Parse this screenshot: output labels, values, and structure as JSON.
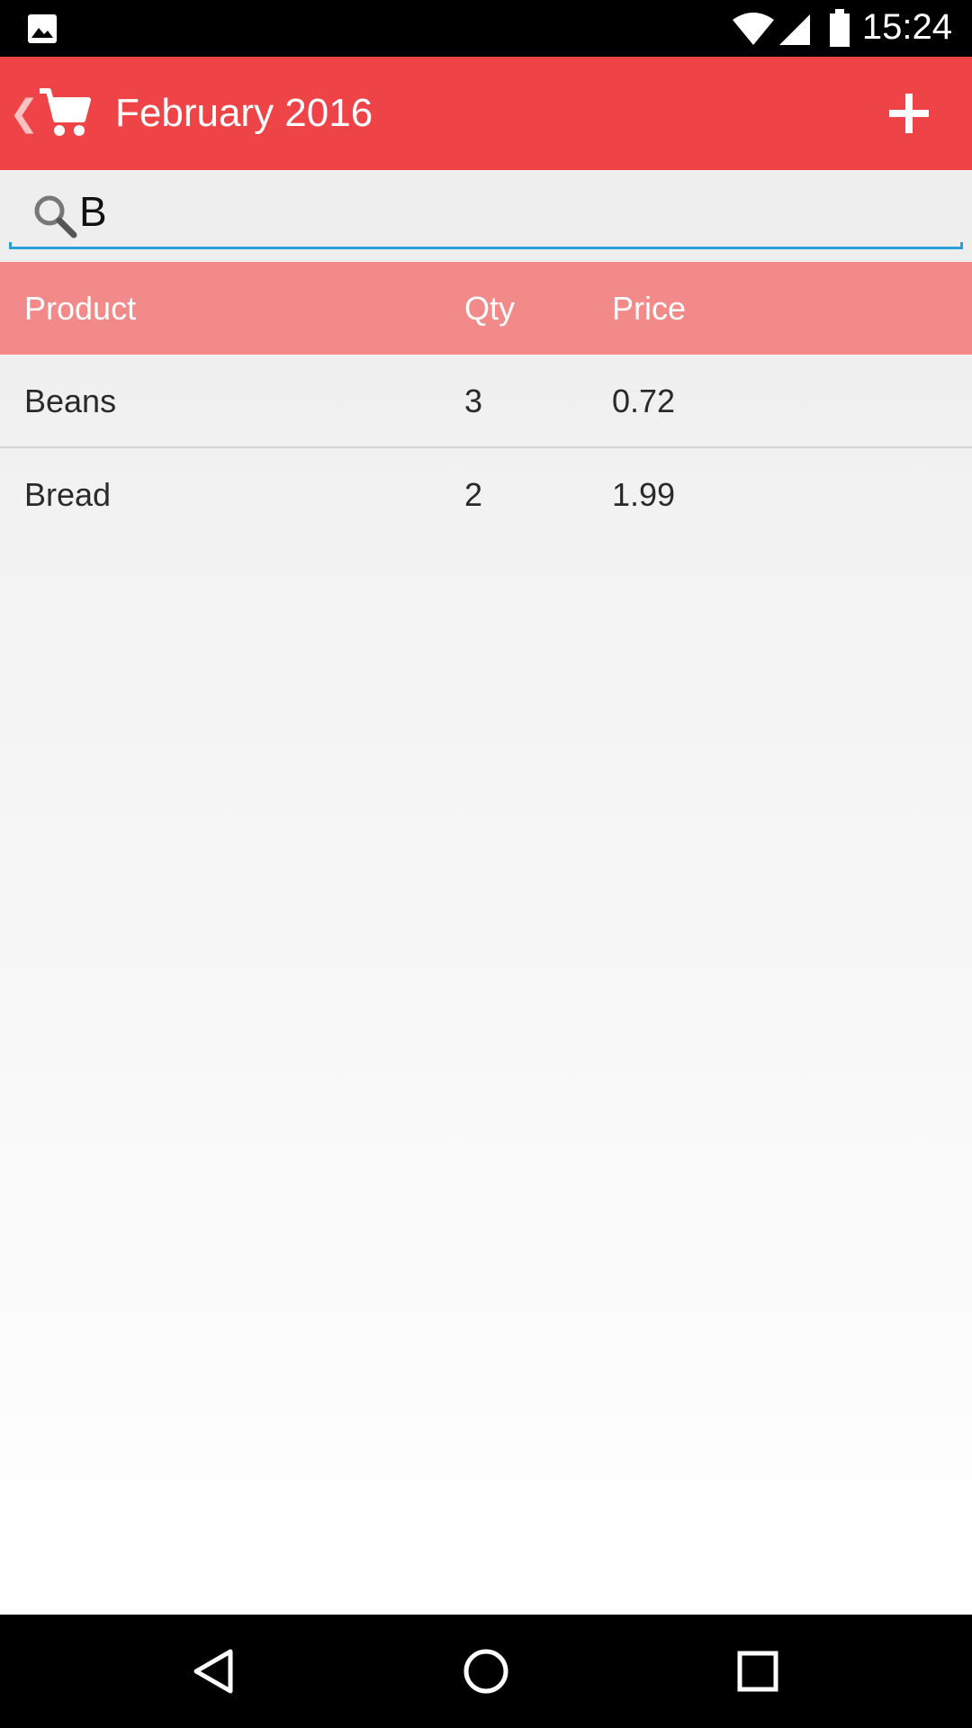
{
  "status_bar": {
    "time": "15:24",
    "icons": [
      "gallery-notification-icon",
      "wifi-icon",
      "cellular-signal-icon",
      "battery-icon"
    ]
  },
  "app_bar": {
    "title": "February 2016",
    "icons": [
      "back-chevron-icon",
      "shopping-cart-icon",
      "add-icon"
    ],
    "color": "#ef4447"
  },
  "search": {
    "value": "B",
    "placeholder": ""
  },
  "table": {
    "headers": [
      "Product",
      "Qty",
      "Price"
    ],
    "rows": [
      {
        "product": "Beans",
        "qty": "3",
        "price": "0.72"
      },
      {
        "product": "Bread",
        "qty": "2",
        "price": "1.99"
      }
    ],
    "header_color": "#f28a8a"
  },
  "nav_bar": {
    "icons": [
      "back-triangle-icon",
      "home-circle-icon",
      "recents-square-icon"
    ]
  }
}
